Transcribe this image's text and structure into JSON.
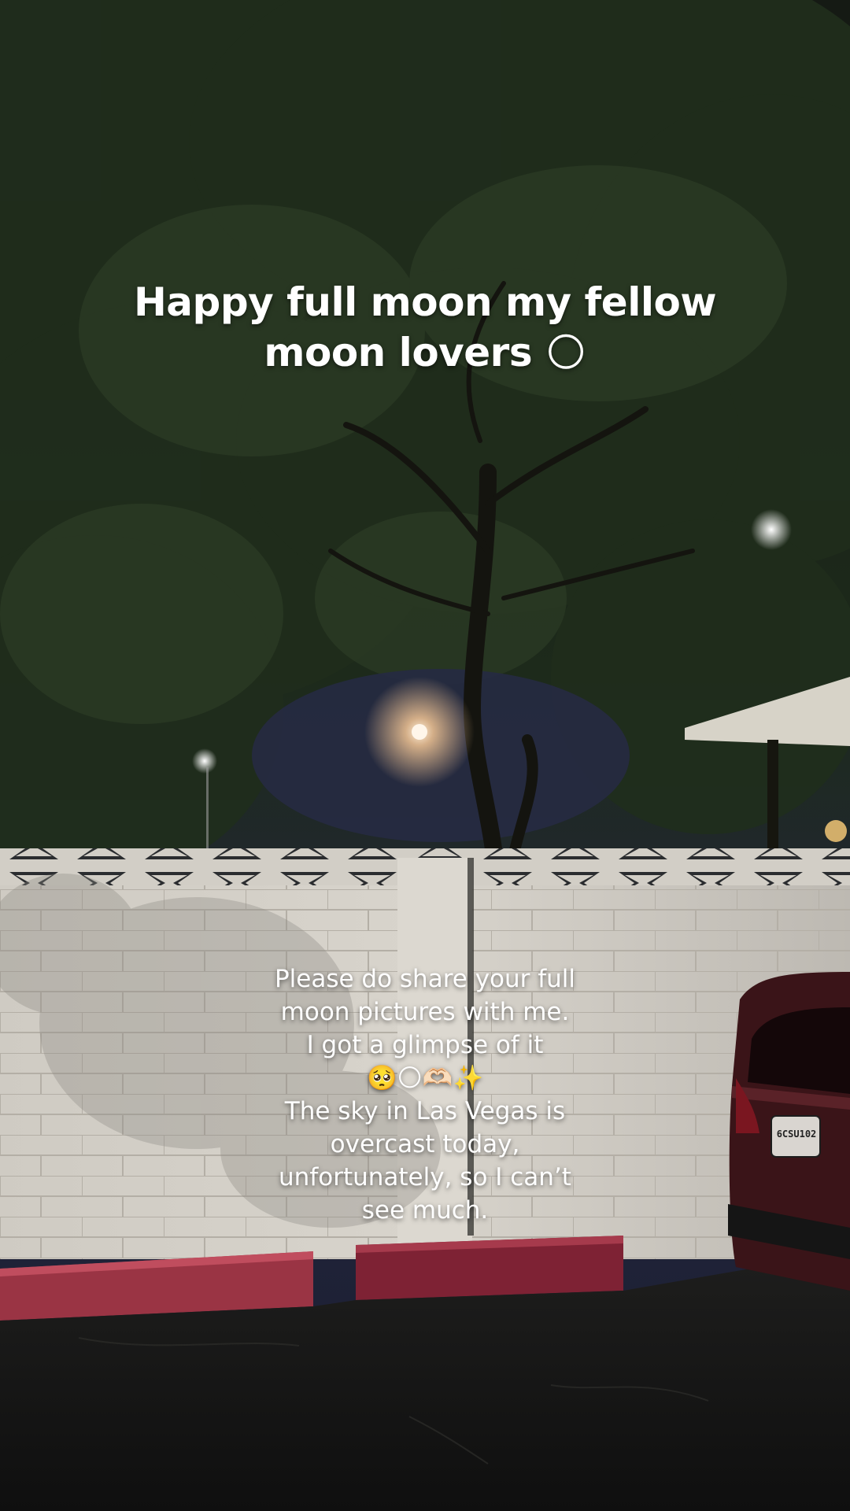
{
  "caption_top": {
    "lines": [
      "Happy full moon my fellow",
      "moon lovers  🌕"
    ]
  },
  "caption_bottom": {
    "lines": [
      "Please do share your full",
      "moon pictures with me.",
      "I got a glimpse of it",
      "🥺🌕🫶🏻✨",
      "The sky in Las Vegas is",
      "overcast today,",
      "unfortunately, so I can’t",
      "see much."
    ]
  },
  "car": {
    "license_plate": "6CSU102"
  },
  "colors": {
    "sky": "#1c2135",
    "foliage": "#243320",
    "wall": "#cfcbc3",
    "curb": "#8a2a3a",
    "asphalt": "#161616",
    "car": "#3a1418",
    "moon_glow": "#ffd9b0"
  }
}
